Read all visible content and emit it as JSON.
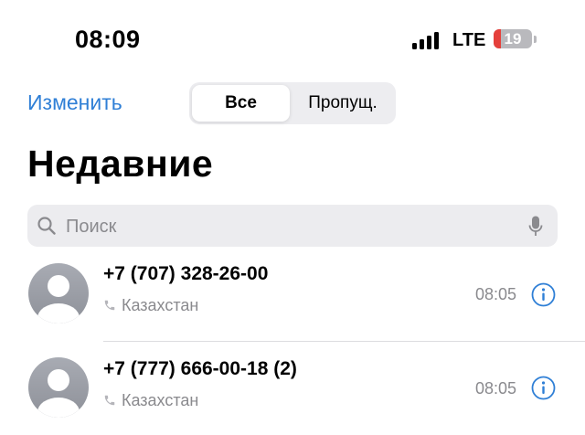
{
  "status_bar": {
    "time": "08:09",
    "network": "LTE",
    "battery_level": "19",
    "battery_fraction": 0.19,
    "battery_color": "#e5403b"
  },
  "nav": {
    "edit_label": "Изменить",
    "segments": [
      {
        "label": "Все",
        "selected": true
      },
      {
        "label": "Пропущ.",
        "selected": false
      }
    ],
    "accent_color": "#2f7fd6"
  },
  "title": "Недавние",
  "search": {
    "placeholder": "Поиск",
    "icon": "search-icon",
    "mic_icon": "mic-icon"
  },
  "calls": [
    {
      "number": "+7 (707) 328-26-00",
      "location": "Казахстан",
      "time": "08:05",
      "icon": "phone-icon"
    },
    {
      "number": "+7 (777) 666-00-18 (2)",
      "location": "Казахстан",
      "time": "08:05",
      "icon": "phone-icon"
    }
  ]
}
